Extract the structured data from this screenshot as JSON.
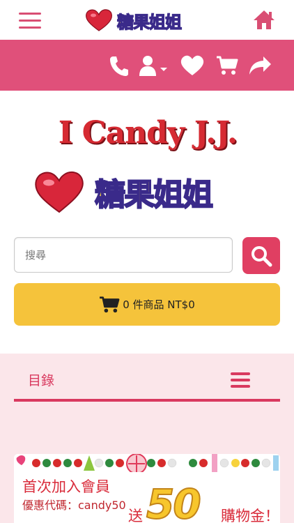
{
  "header": {
    "logo_text": "糖果姐姐"
  },
  "brand": {
    "en_name": "I Candy J.J.",
    "zh_name": "糖果姐姐"
  },
  "search": {
    "placeholder": "搜尋"
  },
  "cart": {
    "summary": "0 件商品 NT$0"
  },
  "catalog": {
    "title": "目錄"
  },
  "promo": {
    "line1": "首次加入會員",
    "line2": "優惠代碼：candy50",
    "prefix": "送",
    "amount": "50",
    "suffix": "購物金！"
  },
  "colors": {
    "accent_pink": "#e0507a",
    "button_red": "#e03f62",
    "cart_yellow": "#f5c33b",
    "catalog_bg": "#fbe6ea"
  }
}
